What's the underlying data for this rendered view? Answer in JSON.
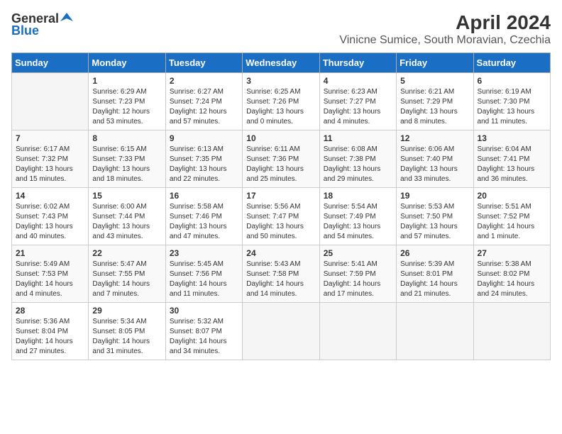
{
  "logo": {
    "general": "General",
    "blue": "Blue"
  },
  "title": "April 2024",
  "location": "Vinicne Sumice, South Moravian, Czechia",
  "days_header": [
    "Sunday",
    "Monday",
    "Tuesday",
    "Wednesday",
    "Thursday",
    "Friday",
    "Saturday"
  ],
  "weeks": [
    [
      {
        "day": "",
        "detail": ""
      },
      {
        "day": "1",
        "detail": "Sunrise: 6:29 AM\nSunset: 7:23 PM\nDaylight: 12 hours\nand 53 minutes."
      },
      {
        "day": "2",
        "detail": "Sunrise: 6:27 AM\nSunset: 7:24 PM\nDaylight: 12 hours\nand 57 minutes."
      },
      {
        "day": "3",
        "detail": "Sunrise: 6:25 AM\nSunset: 7:26 PM\nDaylight: 13 hours\nand 0 minutes."
      },
      {
        "day": "4",
        "detail": "Sunrise: 6:23 AM\nSunset: 7:27 PM\nDaylight: 13 hours\nand 4 minutes."
      },
      {
        "day": "5",
        "detail": "Sunrise: 6:21 AM\nSunset: 7:29 PM\nDaylight: 13 hours\nand 8 minutes."
      },
      {
        "day": "6",
        "detail": "Sunrise: 6:19 AM\nSunset: 7:30 PM\nDaylight: 13 hours\nand 11 minutes."
      }
    ],
    [
      {
        "day": "7",
        "detail": "Sunrise: 6:17 AM\nSunset: 7:32 PM\nDaylight: 13 hours\nand 15 minutes."
      },
      {
        "day": "8",
        "detail": "Sunrise: 6:15 AM\nSunset: 7:33 PM\nDaylight: 13 hours\nand 18 minutes."
      },
      {
        "day": "9",
        "detail": "Sunrise: 6:13 AM\nSunset: 7:35 PM\nDaylight: 13 hours\nand 22 minutes."
      },
      {
        "day": "10",
        "detail": "Sunrise: 6:11 AM\nSunset: 7:36 PM\nDaylight: 13 hours\nand 25 minutes."
      },
      {
        "day": "11",
        "detail": "Sunrise: 6:08 AM\nSunset: 7:38 PM\nDaylight: 13 hours\nand 29 minutes."
      },
      {
        "day": "12",
        "detail": "Sunrise: 6:06 AM\nSunset: 7:40 PM\nDaylight: 13 hours\nand 33 minutes."
      },
      {
        "day": "13",
        "detail": "Sunrise: 6:04 AM\nSunset: 7:41 PM\nDaylight: 13 hours\nand 36 minutes."
      }
    ],
    [
      {
        "day": "14",
        "detail": "Sunrise: 6:02 AM\nSunset: 7:43 PM\nDaylight: 13 hours\nand 40 minutes."
      },
      {
        "day": "15",
        "detail": "Sunrise: 6:00 AM\nSunset: 7:44 PM\nDaylight: 13 hours\nand 43 minutes."
      },
      {
        "day": "16",
        "detail": "Sunrise: 5:58 AM\nSunset: 7:46 PM\nDaylight: 13 hours\nand 47 minutes."
      },
      {
        "day": "17",
        "detail": "Sunrise: 5:56 AM\nSunset: 7:47 PM\nDaylight: 13 hours\nand 50 minutes."
      },
      {
        "day": "18",
        "detail": "Sunrise: 5:54 AM\nSunset: 7:49 PM\nDaylight: 13 hours\nand 54 minutes."
      },
      {
        "day": "19",
        "detail": "Sunrise: 5:53 AM\nSunset: 7:50 PM\nDaylight: 13 hours\nand 57 minutes."
      },
      {
        "day": "20",
        "detail": "Sunrise: 5:51 AM\nSunset: 7:52 PM\nDaylight: 14 hours\nand 1 minute."
      }
    ],
    [
      {
        "day": "21",
        "detail": "Sunrise: 5:49 AM\nSunset: 7:53 PM\nDaylight: 14 hours\nand 4 minutes."
      },
      {
        "day": "22",
        "detail": "Sunrise: 5:47 AM\nSunset: 7:55 PM\nDaylight: 14 hours\nand 7 minutes."
      },
      {
        "day": "23",
        "detail": "Sunrise: 5:45 AM\nSunset: 7:56 PM\nDaylight: 14 hours\nand 11 minutes."
      },
      {
        "day": "24",
        "detail": "Sunrise: 5:43 AM\nSunset: 7:58 PM\nDaylight: 14 hours\nand 14 minutes."
      },
      {
        "day": "25",
        "detail": "Sunrise: 5:41 AM\nSunset: 7:59 PM\nDaylight: 14 hours\nand 17 minutes."
      },
      {
        "day": "26",
        "detail": "Sunrise: 5:39 AM\nSunset: 8:01 PM\nDaylight: 14 hours\nand 21 minutes."
      },
      {
        "day": "27",
        "detail": "Sunrise: 5:38 AM\nSunset: 8:02 PM\nDaylight: 14 hours\nand 24 minutes."
      }
    ],
    [
      {
        "day": "28",
        "detail": "Sunrise: 5:36 AM\nSunset: 8:04 PM\nDaylight: 14 hours\nand 27 minutes."
      },
      {
        "day": "29",
        "detail": "Sunrise: 5:34 AM\nSunset: 8:05 PM\nDaylight: 14 hours\nand 31 minutes."
      },
      {
        "day": "30",
        "detail": "Sunrise: 5:32 AM\nSunset: 8:07 PM\nDaylight: 14 hours\nand 34 minutes."
      },
      {
        "day": "",
        "detail": ""
      },
      {
        "day": "",
        "detail": ""
      },
      {
        "day": "",
        "detail": ""
      },
      {
        "day": "",
        "detail": ""
      }
    ]
  ]
}
